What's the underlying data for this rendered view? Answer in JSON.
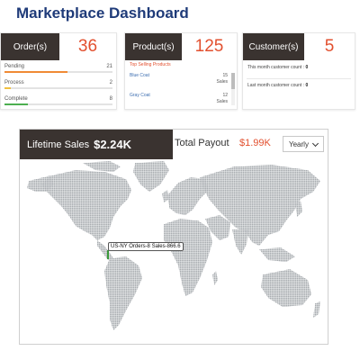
{
  "header": {
    "title": "Marketplace Dashboard"
  },
  "orders": {
    "label": "Order(s)",
    "count": "36",
    "stats": [
      {
        "label": "Pending",
        "value": "21",
        "fraction": 0.58,
        "color": "#f08a35"
      },
      {
        "label": "Process",
        "value": "2",
        "fraction": 0.06,
        "color": "#f0c040"
      },
      {
        "label": "Complete",
        "value": "8",
        "fraction": 0.22,
        "color": "#4caf50"
      }
    ]
  },
  "products": {
    "label": "Product(s)",
    "count": "125",
    "top_heading": "Top Selling Products",
    "items": [
      {
        "name": "Blue Coat",
        "qty": "15",
        "unit": "Sales"
      },
      {
        "name": "Gray Coat",
        "qty": "12",
        "unit": "Sales"
      }
    ]
  },
  "customers": {
    "label": "Customer(s)",
    "count": "5",
    "this_month_label": "This month customer count :",
    "this_month_value": "0",
    "last_month_label": "Last month customer count :",
    "last_month_value": "0"
  },
  "sales": {
    "lifetime_label": "Lifetime Sales",
    "lifetime_value": "$2.24K",
    "payout_label": "Total Payout",
    "payout_value": "$1.99K",
    "period_selected": "Yearly"
  },
  "map": {
    "tooltip": "US-NY Orders-8 Sales-866.6",
    "land_color": "#a8acb0",
    "marker_color": "#3a9a3a"
  }
}
